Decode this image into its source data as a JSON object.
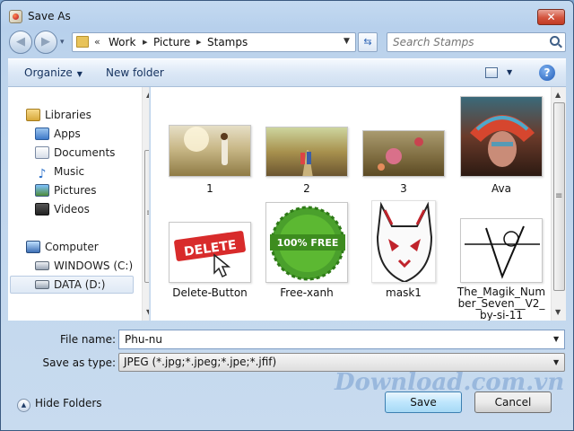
{
  "window": {
    "title": "Save As",
    "close_symbol": "✕"
  },
  "nav_buttons": {
    "back_symbol": "◀",
    "forward_symbol": "▶",
    "dropdown_symbol": "▾"
  },
  "address": {
    "chevron": "«",
    "segments": [
      "Work",
      "Picture",
      "Stamps"
    ],
    "separator": "▸"
  },
  "refresh_symbol": "⇆",
  "search": {
    "placeholder": "Search Stamps"
  },
  "toolbar": {
    "organize_label": "Organize",
    "new_folder_label": "New folder",
    "caret": "▼",
    "help_symbol": "?"
  },
  "sidebar": {
    "libraries_label": "Libraries",
    "items": [
      {
        "label": "Apps",
        "icon": "apps-icon"
      },
      {
        "label": "Documents",
        "icon": "documents-icon"
      },
      {
        "label": "Music",
        "icon": "music-icon"
      },
      {
        "label": "Pictures",
        "icon": "pictures-icon"
      },
      {
        "label": "Videos",
        "icon": "videos-icon"
      }
    ],
    "computer_label": "Computer",
    "drives": [
      {
        "label": "WINDOWS (C:)"
      },
      {
        "label": "DATA (D:)",
        "selected": true
      }
    ],
    "music_glyph": "♪"
  },
  "files": [
    {
      "name": "1"
    },
    {
      "name": "2"
    },
    {
      "name": "3"
    },
    {
      "name": "Ava"
    },
    {
      "name": "Delete-Button",
      "stamp_text": "DELETE"
    },
    {
      "name": "Free-xanh",
      "stamp_text": "100% FREE"
    },
    {
      "name": "mask1"
    },
    {
      "name": "The_Magik_Number_Seven__V2_by-si-11"
    }
  ],
  "form": {
    "file_name_label": "File name:",
    "file_name_value": "Phu-nu",
    "save_type_label": "Save as type:",
    "save_type_value": "JPEG (*.jpg;*.jpeg;*.jpe;*.jfif)",
    "dropdown_symbol": "▼"
  },
  "footer": {
    "hide_folders_label": "Hide Folders",
    "hide_symbol": "▲",
    "save_label": "Save",
    "cancel_label": "Cancel"
  },
  "watermark": {
    "text": "Download.com.vn"
  },
  "colors": {
    "accent": "#3c7fb1",
    "close": "#d3533d",
    "selection": "#dfe9f5"
  }
}
